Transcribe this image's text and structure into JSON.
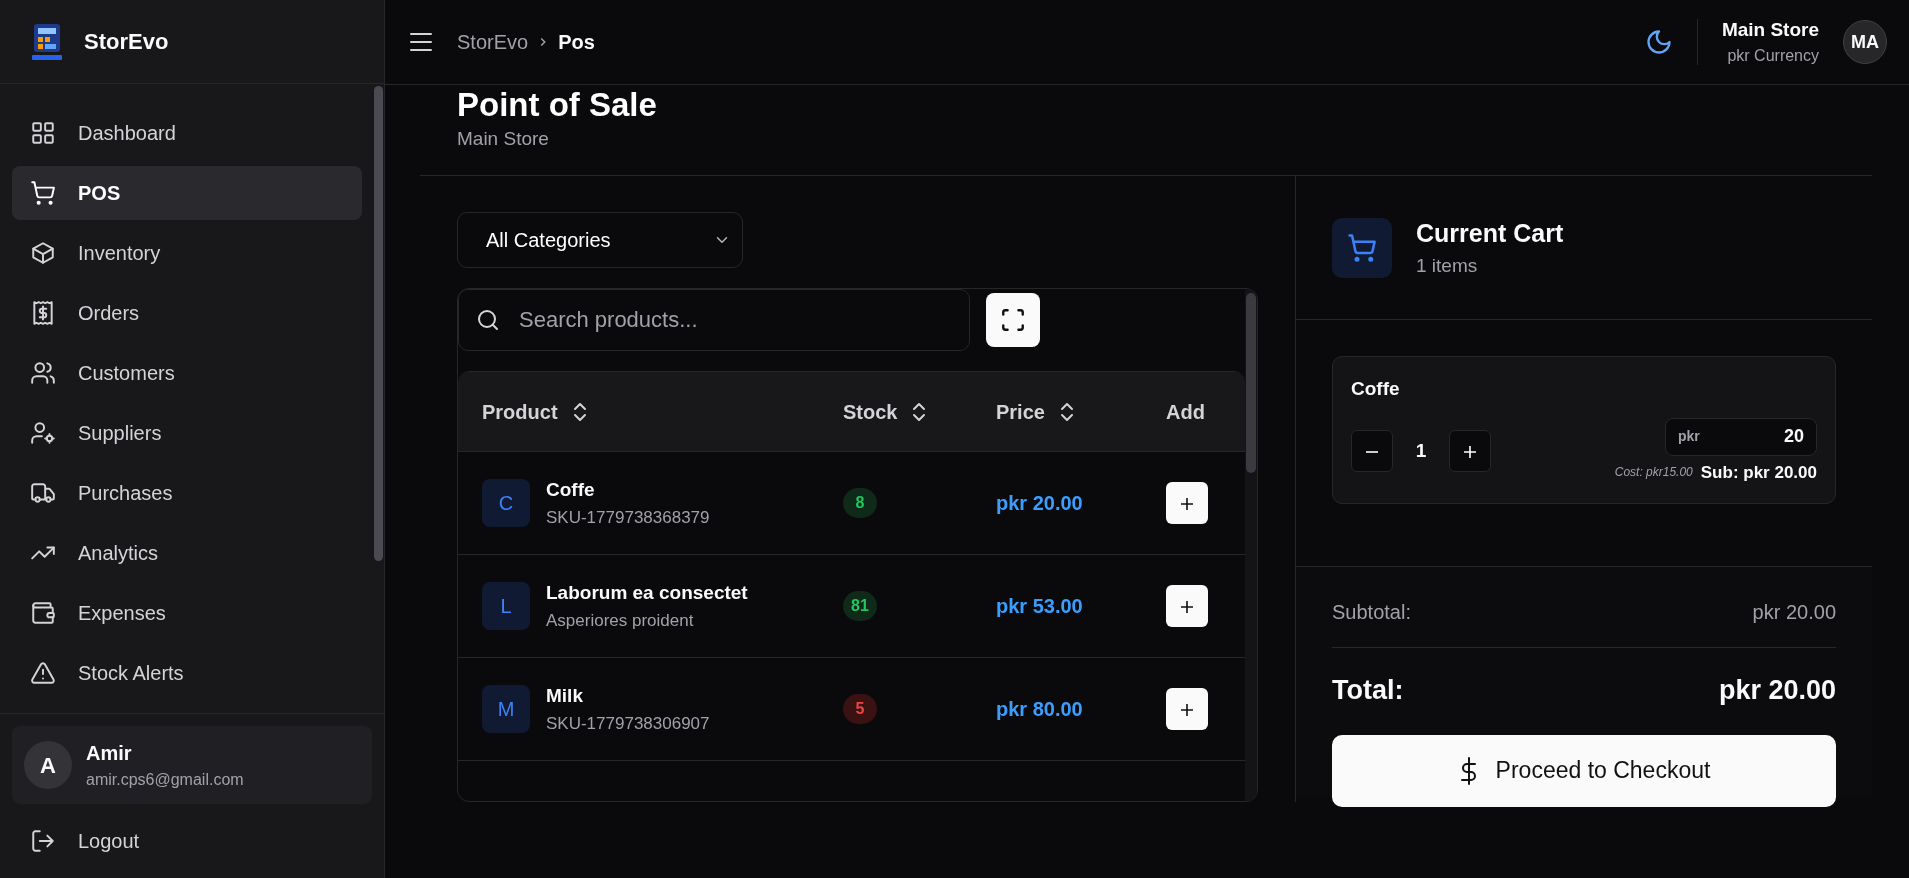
{
  "app": {
    "name": "StorEvo"
  },
  "sidebar": {
    "items": [
      {
        "label": "Dashboard",
        "selected": false
      },
      {
        "label": "POS",
        "selected": true
      },
      {
        "label": "Inventory",
        "selected": false
      },
      {
        "label": "Orders",
        "selected": false
      },
      {
        "label": "Customers",
        "selected": false
      },
      {
        "label": "Suppliers",
        "selected": false
      },
      {
        "label": "Purchases",
        "selected": false
      },
      {
        "label": "Analytics",
        "selected": false
      },
      {
        "label": "Expenses",
        "selected": false
      },
      {
        "label": "Stock Alerts",
        "selected": false
      }
    ],
    "user": {
      "initial": "A",
      "name": "Amir",
      "email": "amir.cps6@gmail.com"
    },
    "logout": "Logout"
  },
  "header": {
    "breadcrumb": [
      "StorEvo",
      "Pos"
    ],
    "store": "Main Store",
    "currency": "pkr Currency",
    "avatar": "MA"
  },
  "page": {
    "title": "Point of Sale",
    "subtitle": "Main Store"
  },
  "filter": {
    "value": "All Categories"
  },
  "search": {
    "placeholder": "Search products..."
  },
  "table": {
    "columns": [
      {
        "label": "Product",
        "sortable": true
      },
      {
        "label": "Stock",
        "sortable": true
      },
      {
        "label": "Price",
        "sortable": true
      },
      {
        "label": "Add",
        "sortable": false
      }
    ],
    "rows": [
      {
        "initial": "C",
        "name": "Coffe",
        "detail": "SKU-1779738368379",
        "stock": "8",
        "low_stock": false,
        "price": "pkr 20.00"
      },
      {
        "initial": "L",
        "name": "Laborum ea consectet",
        "detail": "Asperiores proident",
        "stock": "81",
        "low_stock": false,
        "price": "pkr 53.00"
      },
      {
        "initial": "M",
        "name": "Milk",
        "detail": "SKU-1779738306907",
        "stock": "5",
        "low_stock": true,
        "price": "pkr 80.00"
      }
    ]
  },
  "cart": {
    "title": "Current Cart",
    "count": "1 items",
    "items": [
      {
        "name": "Coffe",
        "quantity": "1",
        "currency": "pkr",
        "price": "20",
        "cost": "Cost: pkr15.00",
        "subtotal": "Sub: pkr 20.00"
      }
    ],
    "subtotal_label": "Subtotal:",
    "subtotal": "pkr 20.00",
    "total_label": "Total:",
    "total": "pkr 20.00",
    "checkout": "Proceed to Checkout"
  }
}
